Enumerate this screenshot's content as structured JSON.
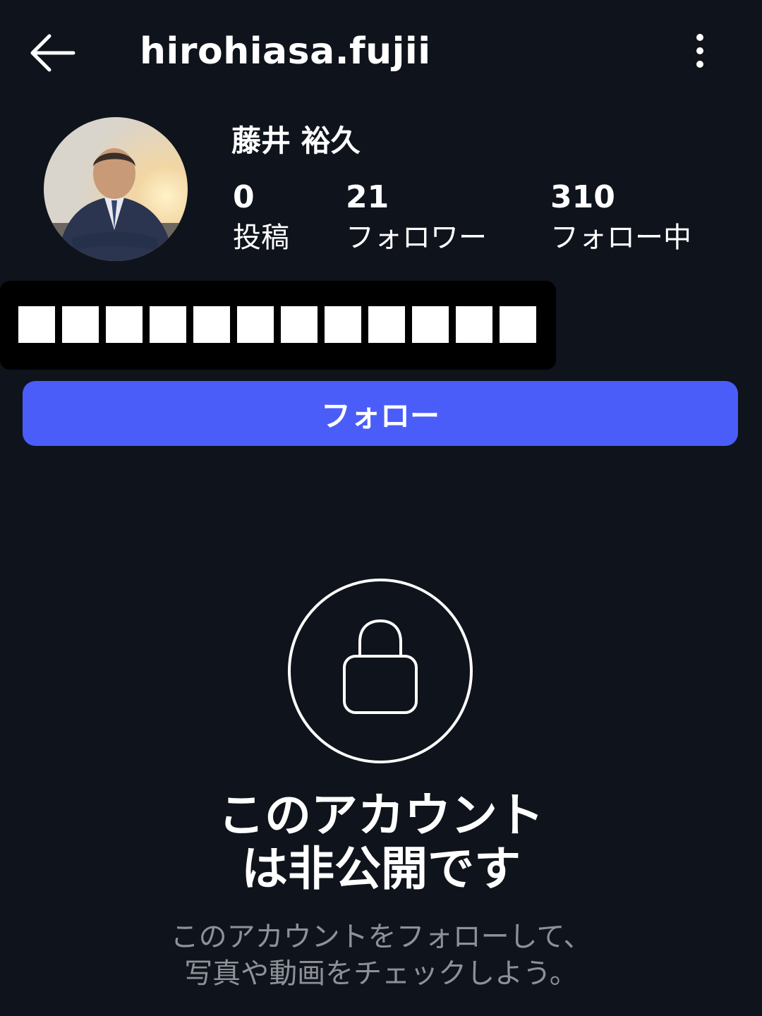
{
  "header": {
    "username": "hirohiasa.fujii"
  },
  "profile": {
    "display_name": "藤井 裕久",
    "stats": {
      "posts": {
        "value": "0",
        "label": "投稿"
      },
      "followers": {
        "value": "21",
        "label": "フォロワー"
      },
      "following": {
        "value": "310",
        "label": "フォロー中"
      }
    }
  },
  "actions": {
    "follow_label": "フォロー"
  },
  "private": {
    "title_line1": "このアカウント",
    "title_line2": "は非公開です",
    "subtitle_line1": "このアカウントをフォローして、",
    "subtitle_line2": "写真や動画をチェックしよう。"
  },
  "icons": {
    "back": "arrow-left-icon",
    "more": "more-vertical-icon",
    "lock": "lock-icon"
  },
  "colors": {
    "background": "#0f131b",
    "follow_button": "#4a5df9",
    "subtitle": "#8e9197"
  }
}
